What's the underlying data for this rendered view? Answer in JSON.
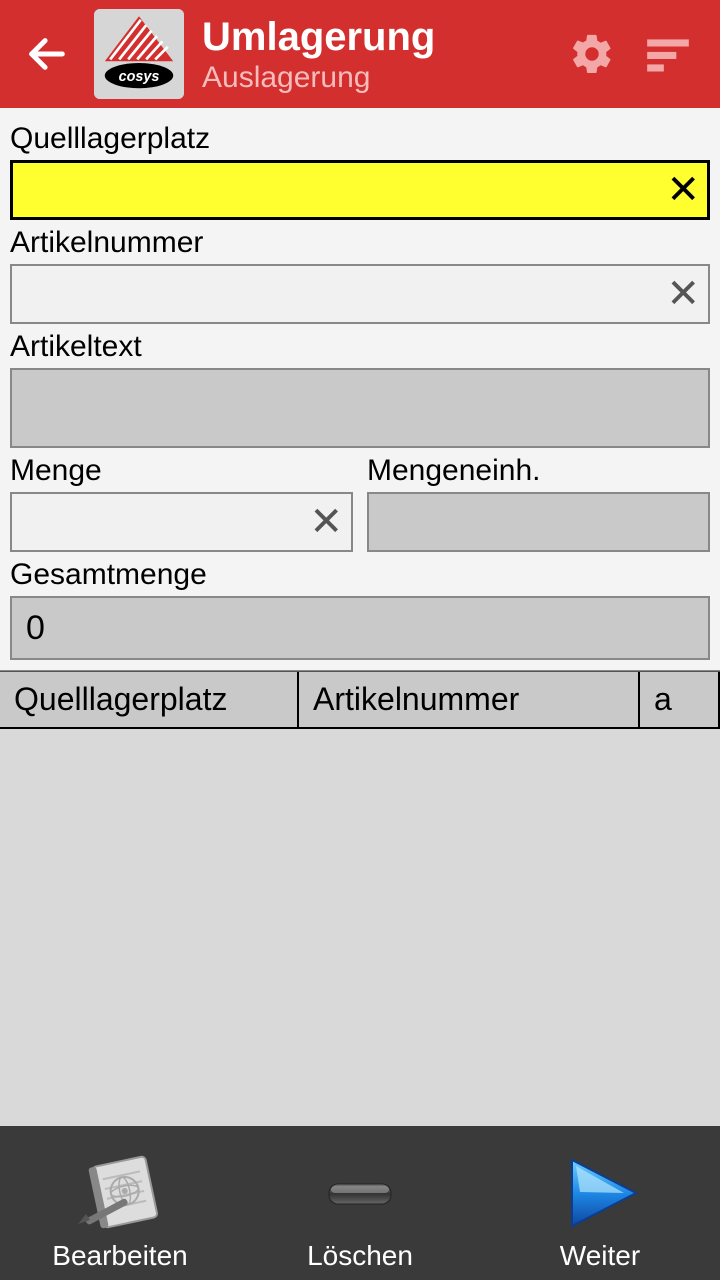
{
  "header": {
    "title": "Umlagerung",
    "subtitle": "Auslagerung"
  },
  "fields": {
    "quelllagerplatz": {
      "label": "Quelllagerplatz",
      "value": ""
    },
    "artikelnummer": {
      "label": "Artikelnummer",
      "value": ""
    },
    "artikeltext": {
      "label": "Artikeltext",
      "value": ""
    },
    "menge": {
      "label": "Menge",
      "value": ""
    },
    "mengeneinh": {
      "label": "Mengeneinh.",
      "value": ""
    },
    "gesamtmenge": {
      "label": "Gesamtmenge",
      "value": "0"
    }
  },
  "table": {
    "columns": [
      "Quelllagerplatz",
      "Artikelnummer",
      "a"
    ]
  },
  "bottom": {
    "edit": "Bearbeiten",
    "delete": "Löschen",
    "next": "Weiter"
  }
}
